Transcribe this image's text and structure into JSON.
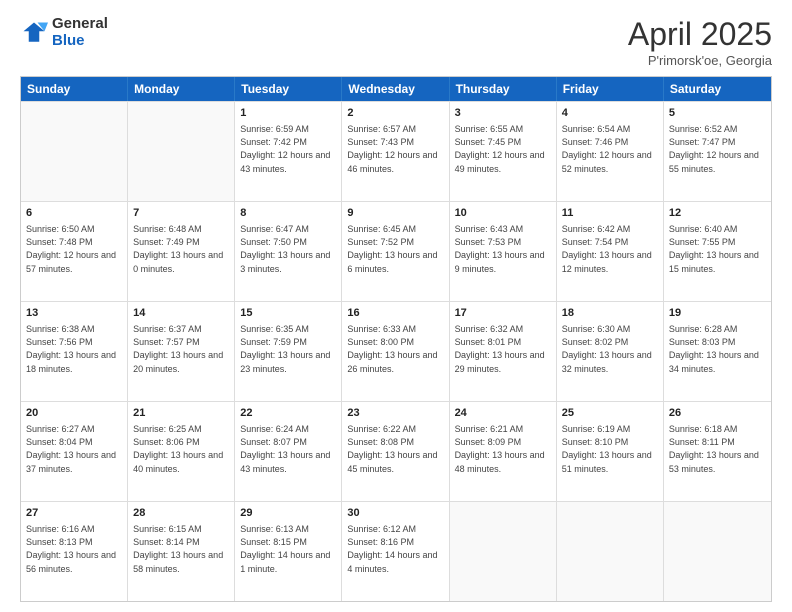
{
  "logo": {
    "general": "General",
    "blue": "Blue"
  },
  "title": "April 2025",
  "subtitle": "P'rimorsk'oe, Georgia",
  "header_days": [
    "Sunday",
    "Monday",
    "Tuesday",
    "Wednesday",
    "Thursday",
    "Friday",
    "Saturday"
  ],
  "weeks": [
    [
      {
        "day": "",
        "sunrise": "",
        "sunset": "",
        "daylight": ""
      },
      {
        "day": "",
        "sunrise": "",
        "sunset": "",
        "daylight": ""
      },
      {
        "day": "1",
        "sunrise": "Sunrise: 6:59 AM",
        "sunset": "Sunset: 7:42 PM",
        "daylight": "Daylight: 12 hours and 43 minutes."
      },
      {
        "day": "2",
        "sunrise": "Sunrise: 6:57 AM",
        "sunset": "Sunset: 7:43 PM",
        "daylight": "Daylight: 12 hours and 46 minutes."
      },
      {
        "day": "3",
        "sunrise": "Sunrise: 6:55 AM",
        "sunset": "Sunset: 7:45 PM",
        "daylight": "Daylight: 12 hours and 49 minutes."
      },
      {
        "day": "4",
        "sunrise": "Sunrise: 6:54 AM",
        "sunset": "Sunset: 7:46 PM",
        "daylight": "Daylight: 12 hours and 52 minutes."
      },
      {
        "day": "5",
        "sunrise": "Sunrise: 6:52 AM",
        "sunset": "Sunset: 7:47 PM",
        "daylight": "Daylight: 12 hours and 55 minutes."
      }
    ],
    [
      {
        "day": "6",
        "sunrise": "Sunrise: 6:50 AM",
        "sunset": "Sunset: 7:48 PM",
        "daylight": "Daylight: 12 hours and 57 minutes."
      },
      {
        "day": "7",
        "sunrise": "Sunrise: 6:48 AM",
        "sunset": "Sunset: 7:49 PM",
        "daylight": "Daylight: 13 hours and 0 minutes."
      },
      {
        "day": "8",
        "sunrise": "Sunrise: 6:47 AM",
        "sunset": "Sunset: 7:50 PM",
        "daylight": "Daylight: 13 hours and 3 minutes."
      },
      {
        "day": "9",
        "sunrise": "Sunrise: 6:45 AM",
        "sunset": "Sunset: 7:52 PM",
        "daylight": "Daylight: 13 hours and 6 minutes."
      },
      {
        "day": "10",
        "sunrise": "Sunrise: 6:43 AM",
        "sunset": "Sunset: 7:53 PM",
        "daylight": "Daylight: 13 hours and 9 minutes."
      },
      {
        "day": "11",
        "sunrise": "Sunrise: 6:42 AM",
        "sunset": "Sunset: 7:54 PM",
        "daylight": "Daylight: 13 hours and 12 minutes."
      },
      {
        "day": "12",
        "sunrise": "Sunrise: 6:40 AM",
        "sunset": "Sunset: 7:55 PM",
        "daylight": "Daylight: 13 hours and 15 minutes."
      }
    ],
    [
      {
        "day": "13",
        "sunrise": "Sunrise: 6:38 AM",
        "sunset": "Sunset: 7:56 PM",
        "daylight": "Daylight: 13 hours and 18 minutes."
      },
      {
        "day": "14",
        "sunrise": "Sunrise: 6:37 AM",
        "sunset": "Sunset: 7:57 PM",
        "daylight": "Daylight: 13 hours and 20 minutes."
      },
      {
        "day": "15",
        "sunrise": "Sunrise: 6:35 AM",
        "sunset": "Sunset: 7:59 PM",
        "daylight": "Daylight: 13 hours and 23 minutes."
      },
      {
        "day": "16",
        "sunrise": "Sunrise: 6:33 AM",
        "sunset": "Sunset: 8:00 PM",
        "daylight": "Daylight: 13 hours and 26 minutes."
      },
      {
        "day": "17",
        "sunrise": "Sunrise: 6:32 AM",
        "sunset": "Sunset: 8:01 PM",
        "daylight": "Daylight: 13 hours and 29 minutes."
      },
      {
        "day": "18",
        "sunrise": "Sunrise: 6:30 AM",
        "sunset": "Sunset: 8:02 PM",
        "daylight": "Daylight: 13 hours and 32 minutes."
      },
      {
        "day": "19",
        "sunrise": "Sunrise: 6:28 AM",
        "sunset": "Sunset: 8:03 PM",
        "daylight": "Daylight: 13 hours and 34 minutes."
      }
    ],
    [
      {
        "day": "20",
        "sunrise": "Sunrise: 6:27 AM",
        "sunset": "Sunset: 8:04 PM",
        "daylight": "Daylight: 13 hours and 37 minutes."
      },
      {
        "day": "21",
        "sunrise": "Sunrise: 6:25 AM",
        "sunset": "Sunset: 8:06 PM",
        "daylight": "Daylight: 13 hours and 40 minutes."
      },
      {
        "day": "22",
        "sunrise": "Sunrise: 6:24 AM",
        "sunset": "Sunset: 8:07 PM",
        "daylight": "Daylight: 13 hours and 43 minutes."
      },
      {
        "day": "23",
        "sunrise": "Sunrise: 6:22 AM",
        "sunset": "Sunset: 8:08 PM",
        "daylight": "Daylight: 13 hours and 45 minutes."
      },
      {
        "day": "24",
        "sunrise": "Sunrise: 6:21 AM",
        "sunset": "Sunset: 8:09 PM",
        "daylight": "Daylight: 13 hours and 48 minutes."
      },
      {
        "day": "25",
        "sunrise": "Sunrise: 6:19 AM",
        "sunset": "Sunset: 8:10 PM",
        "daylight": "Daylight: 13 hours and 51 minutes."
      },
      {
        "day": "26",
        "sunrise": "Sunrise: 6:18 AM",
        "sunset": "Sunset: 8:11 PM",
        "daylight": "Daylight: 13 hours and 53 minutes."
      }
    ],
    [
      {
        "day": "27",
        "sunrise": "Sunrise: 6:16 AM",
        "sunset": "Sunset: 8:13 PM",
        "daylight": "Daylight: 13 hours and 56 minutes."
      },
      {
        "day": "28",
        "sunrise": "Sunrise: 6:15 AM",
        "sunset": "Sunset: 8:14 PM",
        "daylight": "Daylight: 13 hours and 58 minutes."
      },
      {
        "day": "29",
        "sunrise": "Sunrise: 6:13 AM",
        "sunset": "Sunset: 8:15 PM",
        "daylight": "Daylight: 14 hours and 1 minute."
      },
      {
        "day": "30",
        "sunrise": "Sunrise: 6:12 AM",
        "sunset": "Sunset: 8:16 PM",
        "daylight": "Daylight: 14 hours and 4 minutes."
      },
      {
        "day": "",
        "sunrise": "",
        "sunset": "",
        "daylight": ""
      },
      {
        "day": "",
        "sunrise": "",
        "sunset": "",
        "daylight": ""
      },
      {
        "day": "",
        "sunrise": "",
        "sunset": "",
        "daylight": ""
      }
    ]
  ]
}
